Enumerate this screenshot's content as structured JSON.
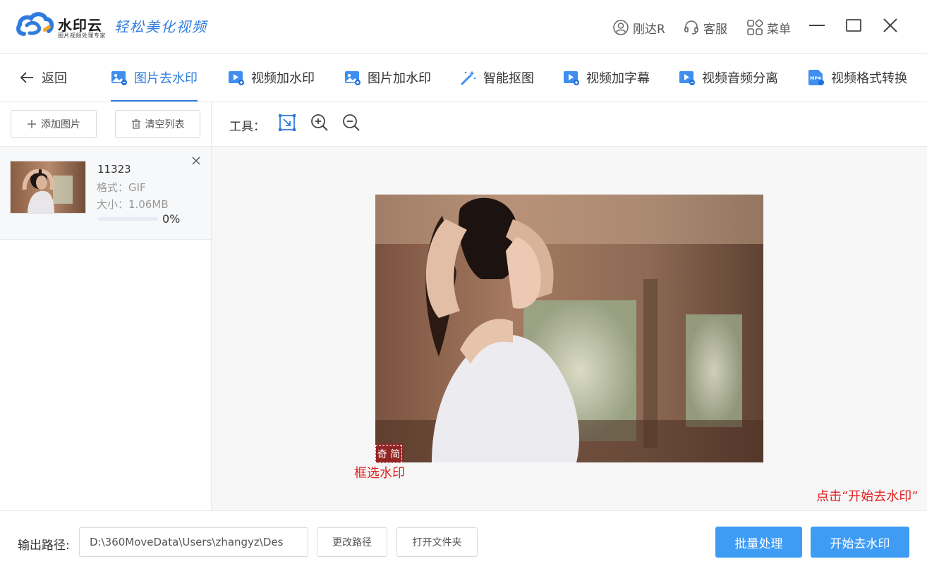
{
  "app": {
    "name": "水印云",
    "subtitle": "图片视频处理专家",
    "slogan": "轻松美化视频"
  },
  "titlebar": {
    "user": "刚达R",
    "service": "客服",
    "menu": "菜单"
  },
  "nav": {
    "back": "返回",
    "tabs": [
      {
        "label": "图片去水印",
        "icon": "image-icon",
        "active": true
      },
      {
        "label": "视频加水印",
        "icon": "video-icon",
        "active": false
      },
      {
        "label": "图片加水印",
        "icon": "image-icon",
        "active": false
      },
      {
        "label": "智能抠图",
        "icon": "magic-wand-icon",
        "active": false
      },
      {
        "label": "视频加字幕",
        "icon": "video-icon",
        "active": false
      },
      {
        "label": "视频音频分离",
        "icon": "video-icon",
        "active": false
      },
      {
        "label": "视频格式转换",
        "icon": "mp4-icon",
        "active": false
      }
    ]
  },
  "left": {
    "add_label": "添加图片",
    "clear_label": "清空列表",
    "files": [
      {
        "name": "11323",
        "format": "格式：GIF",
        "size": "大小：1.06MB",
        "progress_text": "0%",
        "progress": 0
      }
    ]
  },
  "tools": {
    "label": "工具：",
    "items": [
      "select-box-icon",
      "zoom-in-icon",
      "zoom-out-icon"
    ]
  },
  "preview": {
    "watermark_text": "奇 简"
  },
  "annotations": {
    "box_hint": "框选水印",
    "start_hint": "点击“开始去水印”"
  },
  "bottom": {
    "output_label": "输出路径:",
    "output_path": "D:\\360MoveData\\Users\\zhangyz\\Des",
    "change_path": "更改路径",
    "open_folder": "打开文件夹",
    "batch": "批量处理",
    "start": "开始去水印"
  },
  "colors": {
    "accent": "#2f7ce0",
    "primary_button": "#3f9cf5",
    "annotation": "#e02020"
  }
}
